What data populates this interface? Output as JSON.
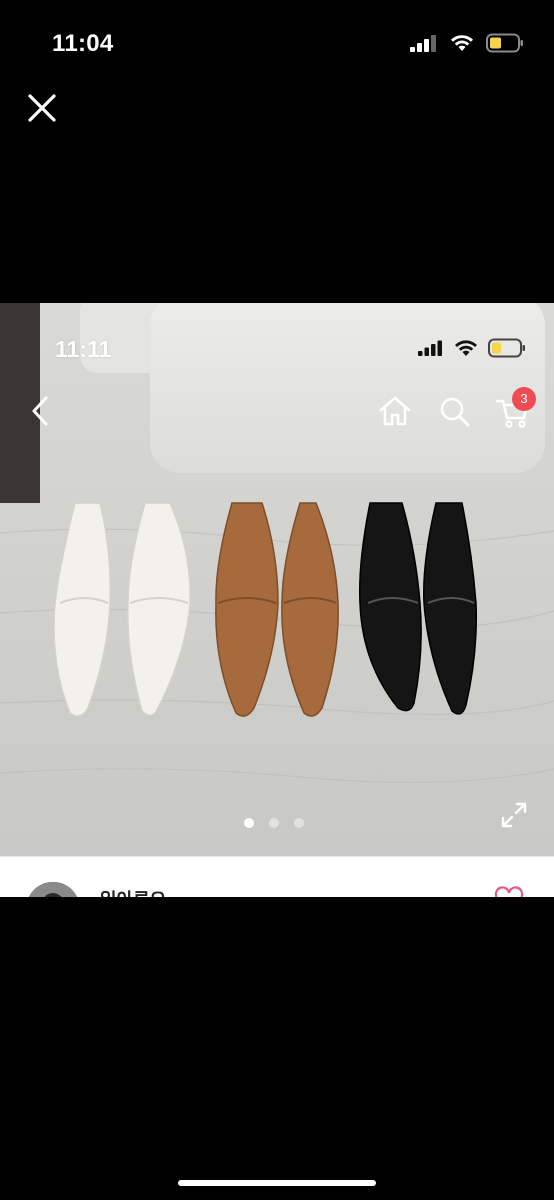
{
  "status_bar": {
    "time": "11:04",
    "icons": [
      "cellular-signal-icon",
      "wifi-icon",
      "battery-icon"
    ],
    "battery_color": "#f5d54a"
  },
  "viewer_controls": {
    "close_icon": "close-icon"
  },
  "screenshot": {
    "status_bar": {
      "time": "11:11",
      "icons": [
        "cellular-signal-icon",
        "wifi-icon",
        "battery-icon"
      ]
    },
    "nav": {
      "back_icon": "back-chevron-icon",
      "home_icon": "home-icon",
      "search_icon": "search-icon",
      "cart_icon": "cart-icon",
      "cart_count": "3",
      "badge_color": "#ef4b54"
    },
    "gallery": {
      "total_images": 3,
      "active_index": 0,
      "expand_icon": "expand-icon",
      "image_subject": "three pairs of pointed slingback loafers: white, tan brown, black"
    },
    "seller": {
      "name": "일아루오",
      "like_icon": "heart-icon",
      "heart_color": "#e7577a"
    }
  }
}
